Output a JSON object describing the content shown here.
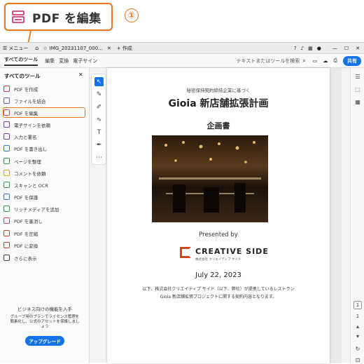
{
  "callout": {
    "label": "PDF を編集",
    "step": "①"
  },
  "titlebar": {
    "menu": "メニュー",
    "tab_title": "IMG_20231107_000...",
    "new_tab": "+ 作成"
  },
  "toolbar": {
    "items": [
      "すべてのツール",
      "編集",
      "変換",
      "電子サイン"
    ],
    "search": "テキストまたはツールを検索",
    "share": "共有"
  },
  "sidebar": {
    "header": "すべてのツール",
    "items": [
      {
        "label": "PDF を作成",
        "icon": "create-pdf-icon",
        "color": "#d23c3c"
      },
      {
        "label": "ファイルを結合",
        "icon": "combine-icon",
        "color": "#6a5acd"
      },
      {
        "label": "PDF を編集",
        "icon": "edit-pdf-icon",
        "color": "#d23c7a"
      },
      {
        "label": "電子サインを依頼",
        "icon": "sign-request-icon",
        "color": "#7b3fb5"
      },
      {
        "label": "入力と署名",
        "icon": "fill-sign-icon",
        "color": "#7b3fb5"
      },
      {
        "label": "PDF を書き出し",
        "icon": "export-pdf-icon",
        "color": "#2b7bd6"
      },
      {
        "label": "ページを整理",
        "icon": "organize-pages-icon",
        "color": "#2e9e4a"
      },
      {
        "label": "コメントを依頼",
        "icon": "comment-icon",
        "color": "#e2a600"
      },
      {
        "label": "スキャンと OCR",
        "icon": "scan-ocr-icon",
        "color": "#2e9e4a"
      },
      {
        "label": "PDF を保護",
        "icon": "protect-icon",
        "color": "#2b7bd6"
      },
      {
        "label": "リッチメディアを追加",
        "icon": "rich-media-icon",
        "color": "#2e9e4a"
      },
      {
        "label": "PDF を墨消し",
        "icon": "redact-icon",
        "color": "#d23c7a"
      },
      {
        "label": "PDF を圧縮",
        "icon": "compress-icon",
        "color": "#d23c3c"
      },
      {
        "label": "PDF に変換",
        "icon": "convert-icon",
        "color": "#d23c3c"
      },
      {
        "label": "さらに表示",
        "icon": "more-tools-icon",
        "color": "#444"
      }
    ],
    "promo_title": "ビジネス向けの機能を入手",
    "promo_body": "グループ用のプランでライセンス管理を簡素化し、公式のアセットを保護しましょう",
    "upgrade": "アップグレード"
  },
  "document": {
    "confidential": "秘密保持契約締結企業に基づく",
    "title": "Gioia 新店舗拡張計画",
    "subtitle": "企画書",
    "presented_by": "Presented by",
    "company": "CREATIVE SIDE",
    "company_sub": "株式会社 クリエイティブ サイド",
    "date": "July 22, 2023",
    "body1": "以下、株式会社クリエイティブ サイド（以下、弊社）が提携しているレストラン",
    "body2": "Gioia 新店舗拡張プロジェクトに関する契約内容となります。"
  },
  "rightbar": {
    "page_num": "1",
    "page_total": "1"
  },
  "colors": {
    "accent": "#e87722",
    "share_blue": "#1473e6"
  }
}
